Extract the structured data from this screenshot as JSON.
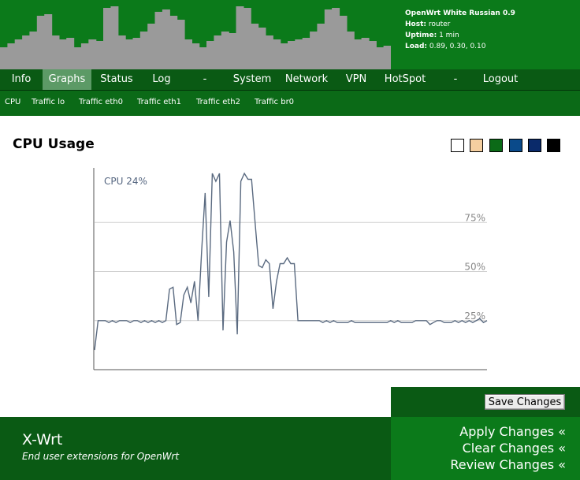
{
  "header": {
    "title": "OpenWrt White Russian 0.9",
    "host_label": "Host:",
    "host_value": "router",
    "uptime_label": "Uptime:",
    "uptime_value": "1 min",
    "load_label": "Load:",
    "load_value": "0.89, 0.30, 0.10"
  },
  "nav": {
    "items": [
      {
        "label": "Info"
      },
      {
        "label": "Graphs"
      },
      {
        "label": "Status"
      },
      {
        "label": "Log"
      },
      {
        "label": "-"
      },
      {
        "label": "System"
      },
      {
        "label": "Network"
      },
      {
        "label": "VPN"
      },
      {
        "label": "HotSpot"
      },
      {
        "label": "-"
      },
      {
        "label": "Logout"
      }
    ],
    "active": "Graphs"
  },
  "subnav": {
    "items": [
      {
        "label": "CPU"
      },
      {
        "label": "Traffic lo"
      },
      {
        "label": "Traffic eth0"
      },
      {
        "label": "Traffic eth1"
      },
      {
        "label": "Traffic eth2"
      },
      {
        "label": "Traffic br0"
      }
    ]
  },
  "page": {
    "title": "CPU Usage"
  },
  "color_swatches": [
    "#ffffff",
    "#f5cfa0",
    "#0b6a17",
    "#0a4a8a",
    "#0a2a6a",
    "#000000"
  ],
  "chart_data": {
    "type": "line",
    "title": "CPU 24%",
    "ylim": [
      0,
      100
    ],
    "gridlines": [
      25,
      50,
      75
    ],
    "tick_labels": [
      "25%",
      "50%",
      "75%"
    ],
    "series": [
      {
        "name": "CPU",
        "color": "#5a6a80",
        "values": [
          10,
          25,
          25,
          25,
          24,
          25,
          24,
          25,
          25,
          25,
          24,
          25,
          25,
          24,
          25,
          24,
          25,
          24,
          25,
          24,
          25,
          41,
          42,
          23,
          24,
          38,
          42,
          34,
          45,
          25,
          60,
          90,
          37,
          100,
          96,
          100,
          20,
          65,
          76,
          60,
          18,
          96,
          100,
          97,
          97,
          75,
          53,
          52,
          56,
          54,
          31,
          45,
          54,
          54,
          57,
          54,
          54,
          25,
          25,
          25,
          25,
          25,
          25,
          25,
          24,
          25,
          24,
          25,
          24,
          24,
          24,
          24,
          25,
          24,
          24,
          24,
          24,
          24,
          24,
          24,
          24,
          24,
          24,
          25,
          24,
          25,
          24,
          24,
          24,
          24,
          25,
          25,
          25,
          25,
          23,
          24,
          25,
          25,
          24,
          24,
          24,
          25,
          24,
          25,
          24,
          25,
          24,
          25,
          26,
          24,
          25
        ]
      }
    ]
  },
  "actions": {
    "save_label": "Save Changes",
    "apply_label": "Apply Changes «",
    "clear_label": "Clear Changes «",
    "review_label": "Review Changes «"
  },
  "footer": {
    "brand": "X-Wrt",
    "tagline": "End user extensions for OpenWrt"
  },
  "colors": {
    "header_green": "#0b7a1a",
    "nav_green": "#0a5a14",
    "active_tab": "#5c9a66",
    "skyline": "#9a9a9a"
  }
}
